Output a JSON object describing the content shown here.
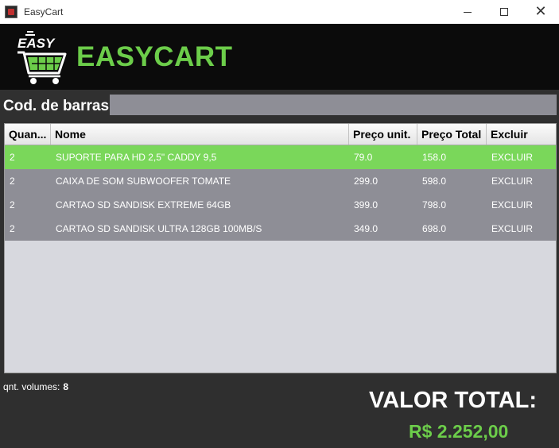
{
  "window": {
    "title": "EasyCart",
    "icon": "app-icon",
    "controls": {
      "minimize": "minimize-icon",
      "maximize": "maximize-icon",
      "close": "close-icon"
    }
  },
  "header": {
    "logo_text": "EASY",
    "brand": "EASYCART",
    "brand_color": "#6ccd4a"
  },
  "barcode": {
    "label": "Cod. de barras:",
    "value": ""
  },
  "table": {
    "columns": [
      "Quan...",
      "Nome",
      "Preço unit.",
      "Preço Total",
      "Excluir"
    ],
    "rows": [
      {
        "qty": "2",
        "name": "SUPORTE PARA HD 2,5\" CADDY 9,5",
        "unit": "79.0",
        "total": "158.0",
        "remove": "EXCLUIR",
        "selected": true
      },
      {
        "qty": "2",
        "name": "CAIXA DE SOM SUBWOOFER TOMATE",
        "unit": "299.0",
        "total": "598.0",
        "remove": "EXCLUIR",
        "selected": false
      },
      {
        "qty": "2",
        "name": "CARTAO SD SANDISK EXTREME 64GB",
        "unit": "399.0",
        "total": "798.0",
        "remove": "EXCLUIR",
        "selected": false
      },
      {
        "qty": "2",
        "name": "CARTAO SD SANDISK ULTRA 128GB 100MB/S",
        "unit": "349.0",
        "total": "698.0",
        "remove": "EXCLUIR",
        "selected": false
      }
    ],
    "selected_color": "#7ad75a",
    "row_color": "#8e8e96"
  },
  "footer": {
    "volumes_label": "qnt. volumes:",
    "volumes_value": "8",
    "total_label": "VALOR TOTAL:",
    "total_value": "R$ 2.252,00"
  }
}
